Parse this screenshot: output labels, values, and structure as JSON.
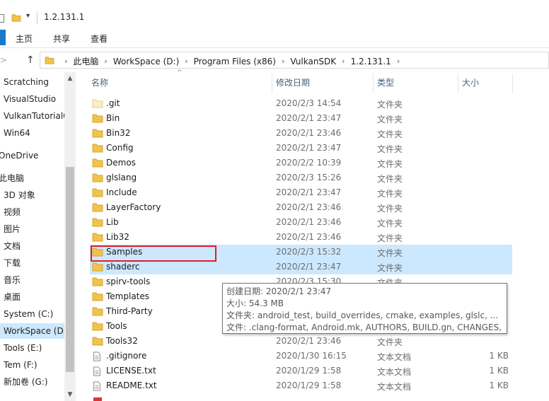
{
  "window": {
    "title": "1.2.131.1"
  },
  "ribbon": {
    "tabs": [
      "主页",
      "共享",
      "查看"
    ]
  },
  "address": {
    "crumbs": [
      "此电脑",
      "WorkSpace (D:)",
      "Program Files (x86)",
      "VulkanSDK",
      "1.2.131.1"
    ]
  },
  "nav": {
    "items": [
      {
        "label": "Scratching"
      },
      {
        "label": "VisualStudio"
      },
      {
        "label": "VulkanTutorialC"
      },
      {
        "label": "Win64"
      },
      {
        "label": "OneDrive"
      },
      {
        "label": "此电脑"
      },
      {
        "label": "3D 对象"
      },
      {
        "label": "视频"
      },
      {
        "label": "图片"
      },
      {
        "label": "文档"
      },
      {
        "label": "下载"
      },
      {
        "label": "音乐"
      },
      {
        "label": "桌面"
      },
      {
        "label": "System (C:)"
      },
      {
        "label": "WorkSpace (D:"
      },
      {
        "label": "Tools (E:)"
      },
      {
        "label": "Tem (F:)"
      },
      {
        "label": "新加卷 (G:)"
      }
    ]
  },
  "columns": {
    "name": "名称",
    "date": "修改日期",
    "type": "类型",
    "size": "大小"
  },
  "files": [
    {
      "name": ".git",
      "date": "2020/2/3 14:54",
      "type": "文件夹",
      "size": "",
      "icon": "folder-light-icon"
    },
    {
      "name": "Bin",
      "date": "2020/2/1 23:47",
      "type": "文件夹",
      "size": "",
      "icon": "folder-icon"
    },
    {
      "name": "Bin32",
      "date": "2020/2/1 23:46",
      "type": "文件夹",
      "size": "",
      "icon": "folder-icon"
    },
    {
      "name": "Config",
      "date": "2020/2/1 23:47",
      "type": "文件夹",
      "size": "",
      "icon": "folder-icon"
    },
    {
      "name": "Demos",
      "date": "2020/2/2 10:39",
      "type": "文件夹",
      "size": "",
      "icon": "folder-icon"
    },
    {
      "name": "glslang",
      "date": "2020/2/3 15:26",
      "type": "文件夹",
      "size": "",
      "icon": "folder-icon"
    },
    {
      "name": "Include",
      "date": "2020/2/1 23:47",
      "type": "文件夹",
      "size": "",
      "icon": "folder-icon"
    },
    {
      "name": "LayerFactory",
      "date": "2020/2/1 23:46",
      "type": "文件夹",
      "size": "",
      "icon": "folder-icon"
    },
    {
      "name": "Lib",
      "date": "2020/2/1 23:46",
      "type": "文件夹",
      "size": "",
      "icon": "folder-icon"
    },
    {
      "name": "Lib32",
      "date": "2020/2/1 23:46",
      "type": "文件夹",
      "size": "",
      "icon": "folder-icon"
    },
    {
      "name": "Samples",
      "date": "2020/2/3 15:32",
      "type": "文件夹",
      "size": "",
      "icon": "folder-icon"
    },
    {
      "name": "shaderc",
      "date": "2020/2/1 23:47",
      "type": "文件夹",
      "size": "",
      "icon": "folder-icon"
    },
    {
      "name": "spirv-tools",
      "date": "2020/2/3 15:30",
      "type": "文件夹",
      "size": "",
      "icon": "folder-icon"
    },
    {
      "name": "Templates",
      "date": "",
      "type": "",
      "size": "",
      "icon": "folder-icon"
    },
    {
      "name": "Third-Party",
      "date": "",
      "type": "",
      "size": "",
      "icon": "folder-icon"
    },
    {
      "name": "Tools",
      "date": "",
      "type": "",
      "size": "",
      "icon": "folder-icon"
    },
    {
      "name": "Tools32",
      "date": "2020/2/1 23:46",
      "type": "文件夹",
      "size": "",
      "icon": "folder-icon"
    },
    {
      "name": ".gitignore",
      "date": "2020/1/30 16:15",
      "type": "文本文档",
      "size": "1 KB",
      "icon": "text-file-icon"
    },
    {
      "name": "LICENSE.txt",
      "date": "2020/1/29 1:58",
      "type": "文本文档",
      "size": "1 KB",
      "icon": "text-file-icon"
    },
    {
      "name": "README.txt",
      "date": "2020/1/29 1:58",
      "type": "文本文档",
      "size": "1 KB",
      "icon": "text-file-icon"
    }
  ],
  "tooltip": {
    "lines": [
      "创建日期: 2020/2/1 23:47",
      "大小: 54.3 MB",
      "文件夹: android_test, build_overrides, cmake, examples, glslc, ...",
      "文件: .clang-format, Android.mk, AUTHORS, BUILD.gn, CHANGES, ..."
    ]
  },
  "colors": {
    "accent": "#1979ca",
    "selection": "#cce8ff",
    "highlight_box": "#e11d2b",
    "folder": "#f0c44c"
  }
}
